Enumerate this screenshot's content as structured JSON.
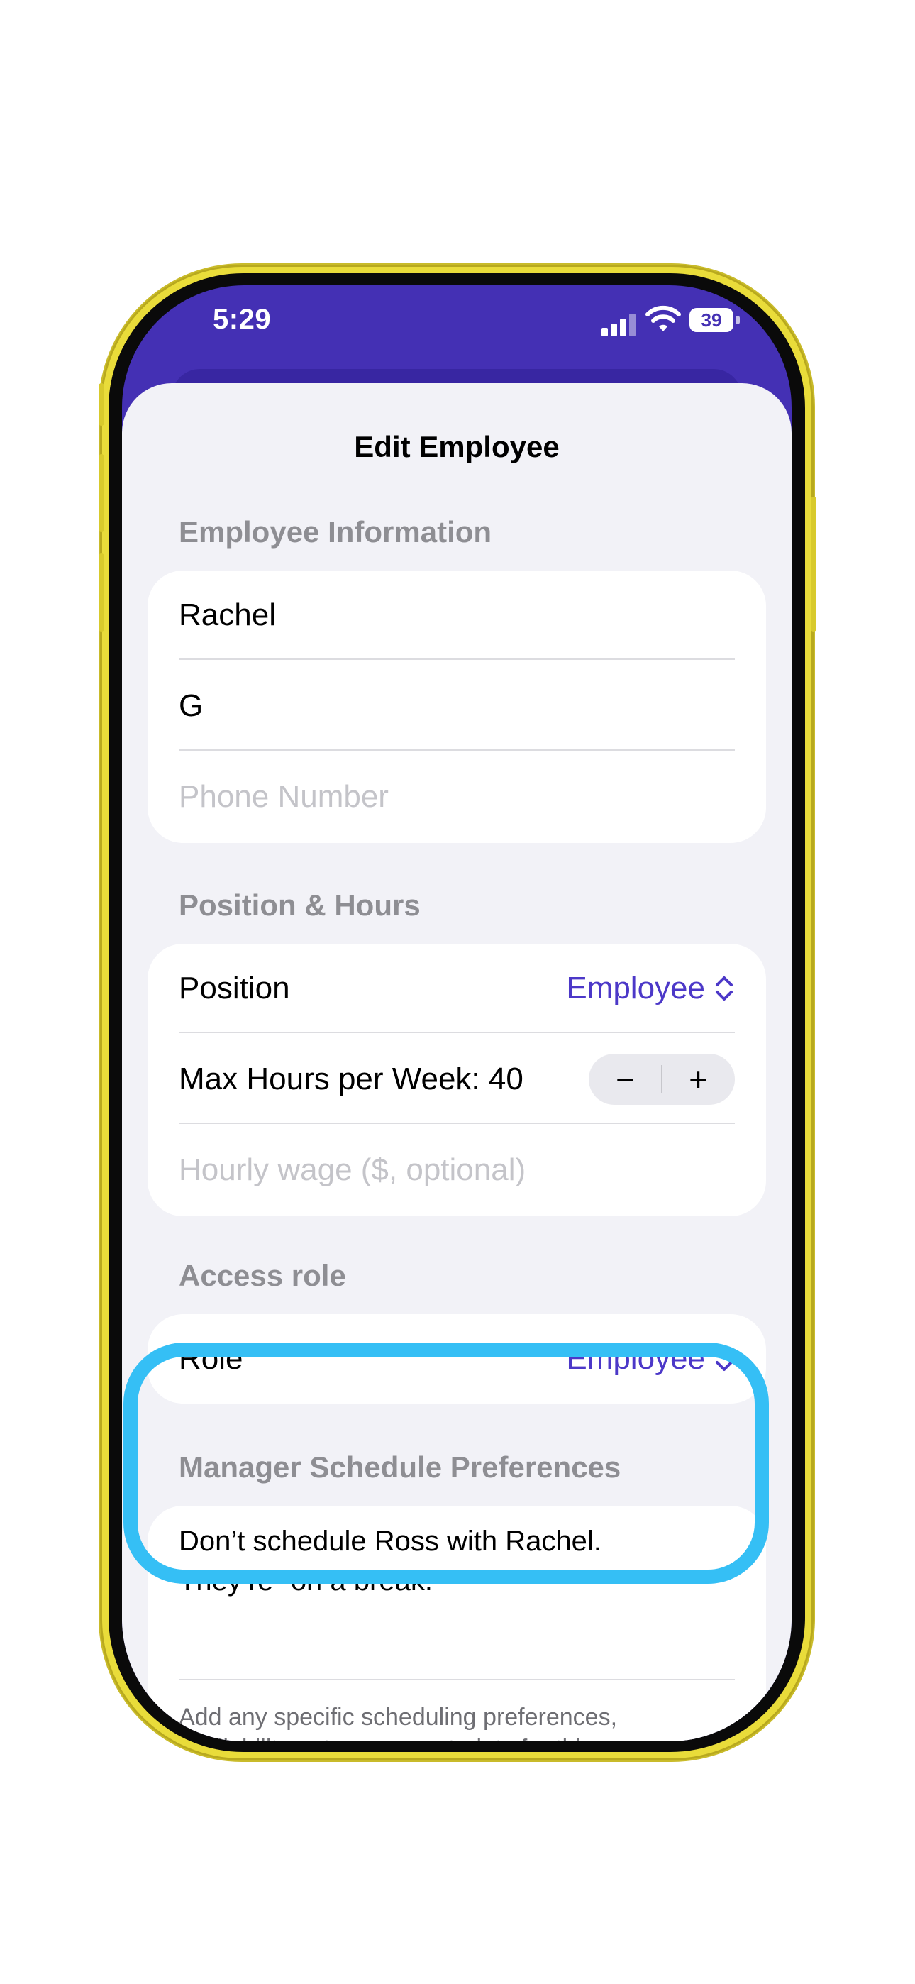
{
  "status_bar": {
    "time": "5:29",
    "battery": "39"
  },
  "sheet": {
    "title": "Edit Employee"
  },
  "employee_info": {
    "header": "Employee Information",
    "first_name": "Rachel",
    "last_name": "G",
    "phone_placeholder": "Phone Number"
  },
  "position_hours": {
    "header": "Position & Hours",
    "position_label": "Position",
    "position_value": "Employee",
    "max_hours_label": "Max Hours per Week: 40",
    "minus": "−",
    "plus": "+",
    "wage_placeholder": "Hourly wage ($, optional)"
  },
  "access_role": {
    "header": "Access role",
    "role_label": "Role",
    "role_value": "Employee"
  },
  "preferences": {
    "header": "Manager Schedule Preferences",
    "note_line1": "Don’t schedule Ross with Rachel.",
    "note_line2": "They’re “on a break.”",
    "footer": "Add any specific scheduling preferences, availability notes, or constraints for this"
  },
  "colors": {
    "accent": "#4c38c8",
    "header_purple": "#4430b4",
    "highlight": "#35bff5",
    "frame_yellow": "#e9dc3a"
  }
}
